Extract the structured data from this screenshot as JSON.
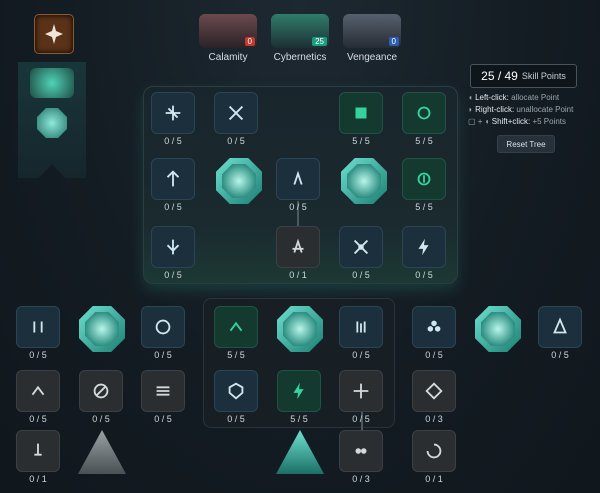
{
  "tabs": [
    {
      "name": "Calamity",
      "points": "0",
      "accent": "#c0392b"
    },
    {
      "name": "Cybernetics",
      "points": "25",
      "accent": "#1a9c7e"
    },
    {
      "name": "Vengeance",
      "points": "0",
      "accent": "#2b5fb5"
    }
  ],
  "skill_points": {
    "value": "25 / 49",
    "label": "Skill Points"
  },
  "instructions": [
    {
      "key": "Left-click:",
      "text": "allocate Point"
    },
    {
      "key": "Right-click:",
      "text": "unallocate Point"
    },
    {
      "key": "Shift+click:",
      "text": "+5 Points"
    }
  ],
  "reset_label": "Reset Tree",
  "nodes": {
    "n1": "0 / 5",
    "n2": "0 / 5",
    "n3": "5 / 5",
    "n4": "5 / 5",
    "n5": "0 / 5",
    "n6": "0 / 5",
    "n7": "5 / 5",
    "n8": "0 / 5",
    "n9": "0 / 1",
    "n10": "0 / 5",
    "n11": "0 / 5",
    "b1": "0 / 5",
    "b2": "0 / 5",
    "b3": "5 / 5",
    "b4": "0 / 5",
    "b5": "0 / 5",
    "b6": "0 / 5",
    "c1": "0 / 5",
    "c2": "0 / 5",
    "c3": "0 / 5",
    "c4": "0 / 5",
    "c5": "5 / 5",
    "c6": "0 / 5",
    "c7": "0 / 3",
    "d1": "0 / 1",
    "d2": "0 / 3",
    "d3": "0 / 1"
  },
  "colors": {
    "accent": "#2fc3a6",
    "node_bg": "#1c2f3c",
    "gray_bg": "#2b2e31"
  }
}
